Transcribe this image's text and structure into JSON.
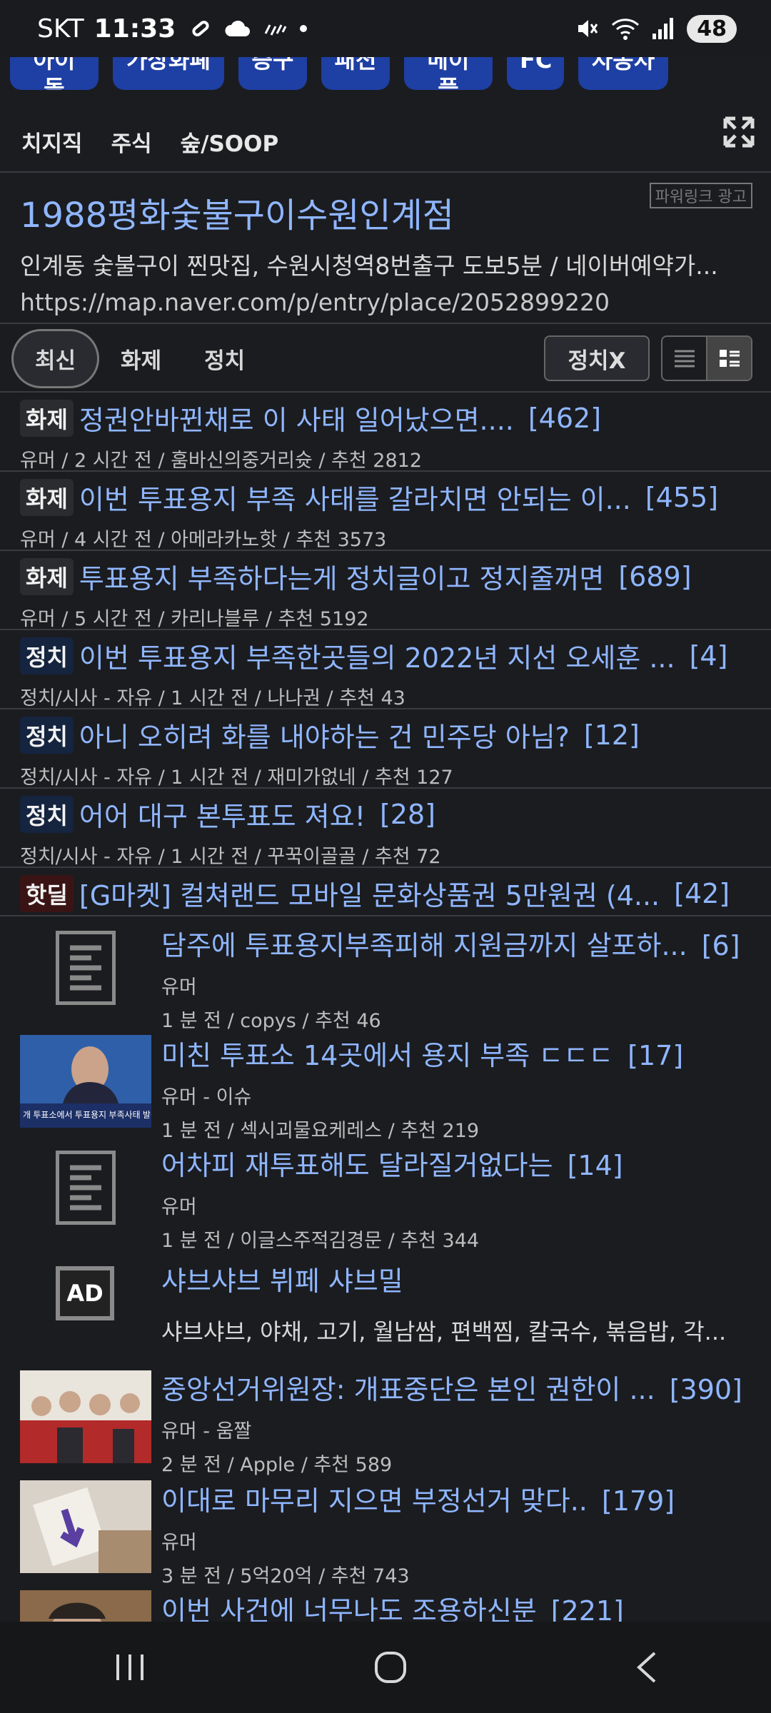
{
  "status": {
    "carrier": "SKT",
    "time": "11:33",
    "battery": "48",
    "icons": [
      "link-icon",
      "cloud-icon",
      "haze-icon",
      "dot-icon"
    ],
    "right_icons": [
      "mute-icon",
      "wifi-icon",
      "signal-icon"
    ]
  },
  "top_chips": [
    "아이돌",
    "가상화폐",
    "증구",
    "패션",
    "메이플",
    "FC",
    "자동차"
  ],
  "subtabs": [
    "치지직",
    "주식",
    "숲/SOOP"
  ],
  "ad": {
    "title": "1988평화숯불구이수원인계점",
    "desc": "인계동 숯불구이 찐맛집, 수원시청역8번출구 도보5분 / 네이버예약가...",
    "url": "https://map.naver.com/p/entry/place/2052899220",
    "logo": "파워링크 광고"
  },
  "filters": {
    "tabs": [
      "최신",
      "화제",
      "정치"
    ],
    "active": "최신",
    "button": "정치X"
  },
  "rows": [
    {
      "badge": "화제",
      "type": "hot",
      "title": "정권안바뀐채로 이 사태 일어났으면....",
      "count": "[462]",
      "meta": "유머 / 2 시간 전 / 훔바신의중거리슛 / 추천 2812"
    },
    {
      "badge": "화제",
      "type": "hot",
      "title": "이번 투표용지 부족 사태를 갈라치면 안되는 이...",
      "count": "[455]",
      "meta": "유머 / 4 시간 전 / 아메라카노핫 / 추천 3573"
    },
    {
      "badge": "화제",
      "type": "hot",
      "title": "투표용지 부족하다는게 정치글이고 정지줄꺼면",
      "count": "[689]",
      "meta": "유머 / 5 시간 전 / 카리나블루 / 추천 5192"
    },
    {
      "badge": "정치",
      "type": "pol",
      "title": "이번 투표용지 부족한곳들의 2022년 지선 오세훈 ...",
      "count": "[4]",
      "meta": "정치/시사 - 자유 / 1 시간 전 / 나나권 / 추천 43"
    },
    {
      "badge": "정치",
      "type": "pol",
      "title": "아니 오히려 화를 내야하는 건 민주당 아님?",
      "count": "[12]",
      "meta": "정치/시사 - 자유 / 1 시간 전 / 재미가없네 / 추천 127"
    },
    {
      "badge": "정치",
      "type": "pol",
      "title": "어어 대구 본투표도 져요!",
      "count": "[28]",
      "meta": "정치/시사 - 자유 / 1 시간 전 / 꾸꾹이골골 / 추천 72"
    },
    {
      "badge": "핫딜",
      "type": "deal",
      "title": "[G마켓] 컬쳐랜드 모바일 문화상품권 5만원권 (4...",
      "count": "[42]",
      "meta": ""
    }
  ],
  "cards": [
    {
      "title": "담주에 투표용지부족피해 지원금까지 살포하...",
      "count": "[6]",
      "sub": "유머",
      "meta": "1 분 전 / copys / 추천 46",
      "thumb": "doc-icon"
    },
    {
      "title": "미친 투표소 14곳에서 용지 부족 ㄷㄷㄷ",
      "count": "[17]",
      "sub": "유머 - 이슈",
      "meta": "1 분 전 / 섹시괴물요케레스 / 추천 219",
      "thumb": "news-photo"
    },
    {
      "title": "어차피 재투표해도 달라질거없다는",
      "count": "[14]",
      "sub": "유머",
      "meta": "1 분 전 / 이글스주적김경문 / 추천 344",
      "thumb": "doc-icon"
    },
    {
      "title": "샤브샤브 뷔페 샤브밀",
      "count": "",
      "sub": "",
      "meta": "샤브샤브, 야채, 고기, 월남쌈, 편백찜, 칼국수, 볶음밥, 각...",
      "thumb": "ad-icon",
      "thumb_label": "AD"
    },
    {
      "title": "중앙선거위원장: 개표중단은 본인 권한이 ...",
      "count": "[390]",
      "sub": "유머 - 움짤",
      "meta": "2 분 전 / Apple / 추천 589",
      "thumb": "group-photo"
    },
    {
      "title": "이대로 마무리 지으면 부정선거 맞다..",
      "count": "[179]",
      "sub": "유머",
      "meta": "3 분 전 / 5억20억 / 추천 743",
      "thumb": "ballot-photo"
    },
    {
      "title": "이번 사건에 너무나도 조용하신분",
      "count": "[221]",
      "sub": "",
      "meta": "",
      "thumb": "face-photo"
    }
  ],
  "news_thumb_caption": "개 투표소에서 투표용지 부족사태 발생"
}
